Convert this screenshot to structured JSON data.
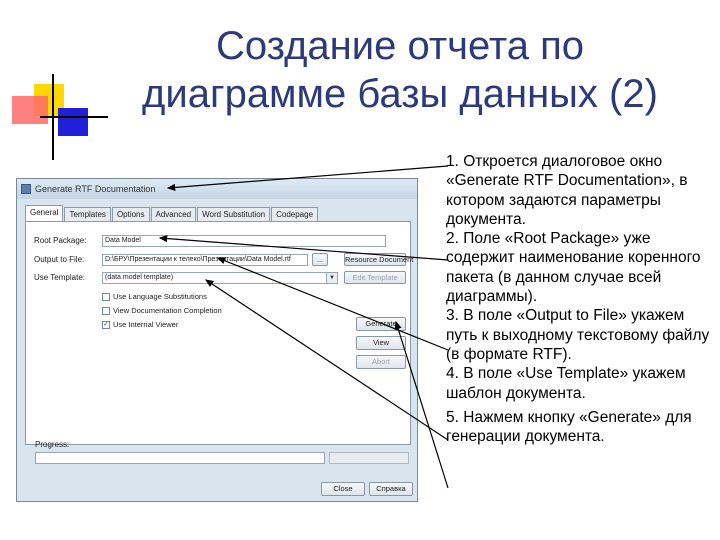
{
  "slide": {
    "title_line1": "Создание отчета по",
    "title_line2": "диаграмме базы данных (2)"
  },
  "bullets": [
    "1. Откроется диалоговое окно «Generate RTF Documentation», в котором задаются параметры документа.",
    "2. Поле «Root Package» уже содержит наименование коренного пакета (в данном случае всей диаграммы).",
    "3. В поле «Output to File» укажем путь к выходному текстовому файлу (в формате RTF).",
    "4. В поле «Use Template» укажем шаблон документа.",
    "5. Нажмем кнопку «Generate» для генерации документа."
  ],
  "dialog": {
    "title": "Generate RTF Documentation",
    "tabs": [
      "General",
      "Templates",
      "Options",
      "Advanced",
      "Word Substitution",
      "Codepage"
    ],
    "root_package_label": "Root Package:",
    "root_package_value": "Data Model",
    "output_label": "Output to File:",
    "output_value": "D:\\БРУ\\Презентации к телеко\\Презентации\\Data Model.rtf",
    "browse_label": "...",
    "use_template_label": "Use Template:",
    "use_template_value": "(data model template)",
    "resource_doc_button": "Resource Document",
    "edit_template_button": "Edit Template",
    "checkboxes": [
      {
        "label": "Use Language Substitutions",
        "checked": false
      },
      {
        "label": "View Documentation Completion",
        "checked": false
      },
      {
        "label": "Use Internal Viewer",
        "checked": true
      }
    ],
    "generate_button": "Generate",
    "view_button": "View",
    "abort_button": "Abort",
    "progress_label": "Progress:",
    "close_button": "Close",
    "help_button": "Справка"
  }
}
